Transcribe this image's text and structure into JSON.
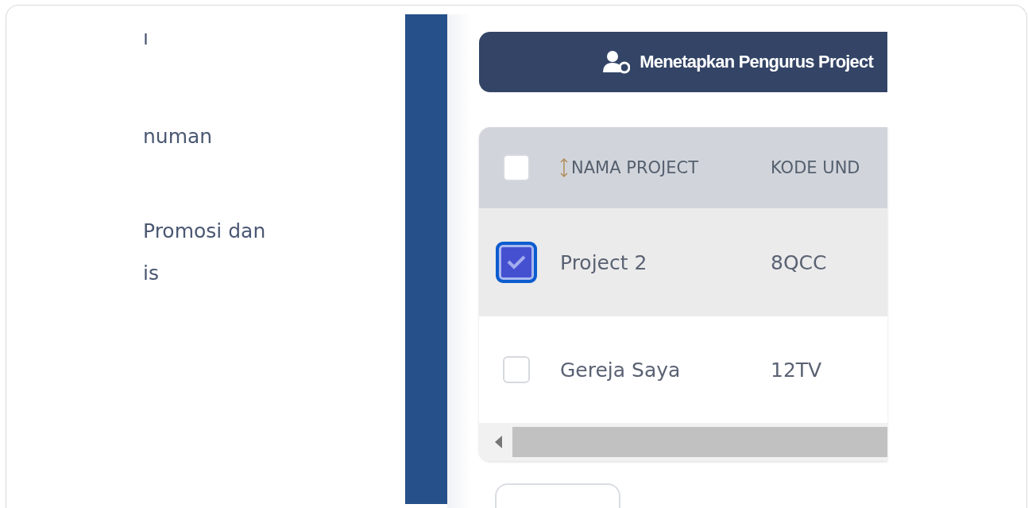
{
  "sidebar": {
    "items": [
      {
        "label": "ı"
      },
      {
        "label": "numan"
      },
      {
        "label": "Promosi dan is"
      }
    ]
  },
  "assign_button": {
    "label": "Menetapkan Pengurus Project"
  },
  "table": {
    "header_checked": false,
    "columns": [
      {
        "label": "NAMA PROJECT",
        "sortable": true
      },
      {
        "label": "KODE UND",
        "sortable": false
      }
    ],
    "rows": [
      {
        "cells": [
          "Project 2",
          "8QCC"
        ],
        "checked": true
      },
      {
        "cells": [
          "Gereja Saya",
          "12TV"
        ],
        "checked": false
      }
    ]
  }
}
